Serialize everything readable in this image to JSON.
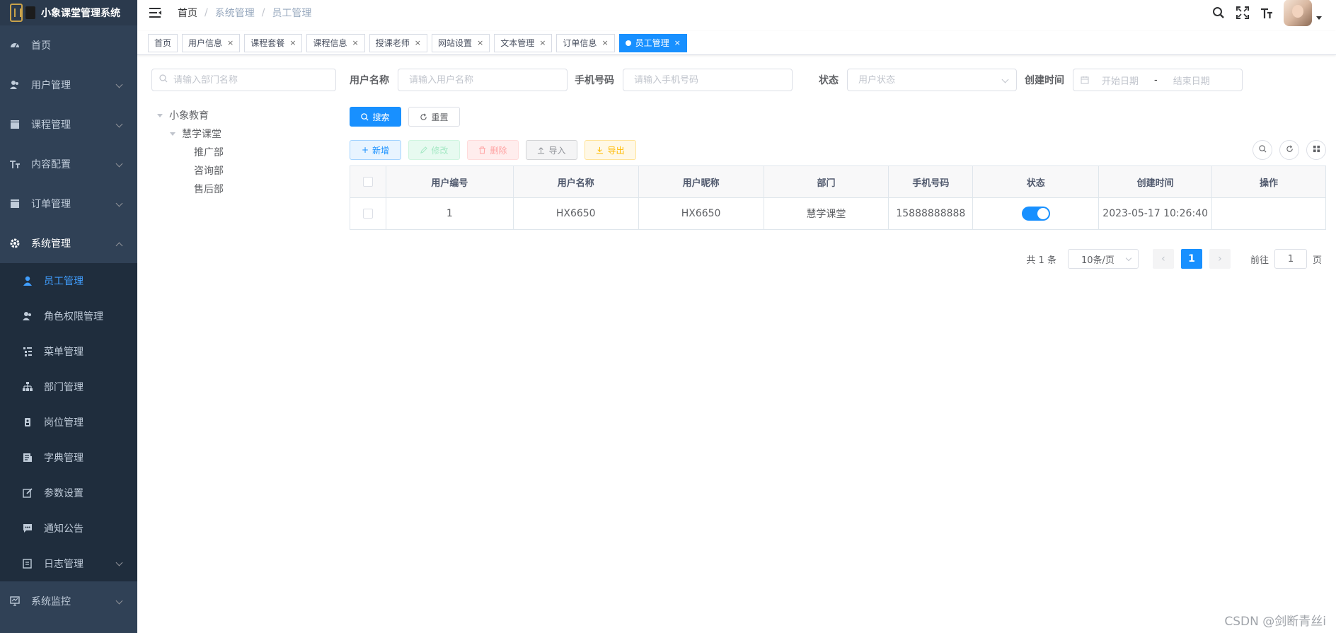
{
  "app": {
    "title": "小象课堂管理系统"
  },
  "sidebar": {
    "items": [
      {
        "label": "首页",
        "icon": "dashboard-icon"
      },
      {
        "label": "用户管理",
        "icon": "user-group-icon"
      },
      {
        "label": "课程管理",
        "icon": "clapperboard-icon"
      },
      {
        "label": "内容配置",
        "icon": "text-size-icon"
      },
      {
        "label": "订单管理",
        "icon": "clapperboard-icon"
      },
      {
        "label": "系统管理",
        "icon": "gear-icon"
      }
    ],
    "submenu": [
      {
        "label": "员工管理",
        "icon": "user-icon"
      },
      {
        "label": "角色权限管理",
        "icon": "peoples-icon"
      },
      {
        "label": "菜单管理",
        "icon": "tree-table-icon"
      },
      {
        "label": "部门管理",
        "icon": "tree-icon"
      },
      {
        "label": "岗位管理",
        "icon": "post-icon"
      },
      {
        "label": "字典管理",
        "icon": "dict-icon"
      },
      {
        "label": "参数设置",
        "icon": "edit-icon"
      },
      {
        "label": "通知公告",
        "icon": "message-icon"
      },
      {
        "label": "日志管理",
        "icon": "log-icon"
      }
    ],
    "monitor": {
      "label": "系统监控",
      "icon": "monitor-icon"
    }
  },
  "breadcrumb": [
    "首页",
    "系统管理",
    "员工管理"
  ],
  "tags": [
    "首页",
    "用户信息",
    "课程套餐",
    "课程信息",
    "授课老师",
    "网站设置",
    "文本管理",
    "订单信息",
    "员工管理"
  ],
  "dept": {
    "search_placeholder": "请输入部门名称",
    "root": "小象教育",
    "child": "慧学课堂",
    "leaves": [
      "推广部",
      "咨询部",
      "售后部"
    ]
  },
  "query": {
    "username_label": "用户名称",
    "username_placeholder": "请输入用户名称",
    "phone_label": "手机号码",
    "phone_placeholder": "请输入手机号码",
    "status_label": "状态",
    "status_placeholder": "用户状态",
    "created_label": "创建时间",
    "start_placeholder": "开始日期",
    "range_sep": "-",
    "end_placeholder": "结束日期",
    "search_btn": "搜索",
    "reset_btn": "重置"
  },
  "toolbar": {
    "add": "新增",
    "edit": "修改",
    "delete": "删除",
    "import": "导入",
    "export": "导出"
  },
  "table": {
    "headers": [
      "用户编号",
      "用户名称",
      "用户昵称",
      "部门",
      "手机号码",
      "状态",
      "创建时间",
      "操作"
    ],
    "rows": [
      {
        "id": "1",
        "name": "HX6650",
        "nick": "HX6650",
        "dept": "慧学课堂",
        "phone": "15888888888",
        "status_on": true,
        "created": "2023-05-17 10:26:40",
        "ops": ""
      }
    ]
  },
  "pagination": {
    "total": "共 1 条",
    "size": "10条/页",
    "current": "1",
    "goto": "前往",
    "goto_value": "1",
    "page_unit": "页"
  },
  "watermark": "CSDN @剑断青丝i",
  "colors": {
    "sidebar_bg": "#304156",
    "primary": "#1890ff",
    "active_menu": "#409eff"
  }
}
